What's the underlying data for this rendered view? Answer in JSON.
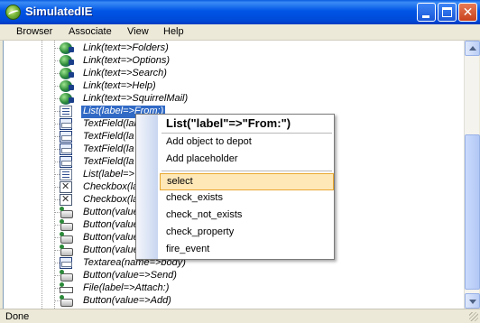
{
  "window": {
    "title": "SimulatedIE"
  },
  "menubar": {
    "items": [
      "Browser",
      "Associate",
      "View",
      "Help"
    ]
  },
  "tree": {
    "rows": [
      {
        "label": "Link(text=>Folders)",
        "icon": "globe-link-icon"
      },
      {
        "label": "Link(text=>Options)",
        "icon": "globe-link-icon"
      },
      {
        "label": "Link(text=>Search)",
        "icon": "globe-link-icon"
      },
      {
        "label": "Link(text=>Help)",
        "icon": "globe-link-icon"
      },
      {
        "label": "Link(text=>SquirrelMail)",
        "icon": "globe-link-icon"
      },
      {
        "label": "List(label=>From:)",
        "icon": "list-icon",
        "selected": true
      },
      {
        "label": "TextField(lab",
        "icon": "textfield-icon"
      },
      {
        "label": "TextField(la",
        "icon": "textfield-icon"
      },
      {
        "label": "TextField(la",
        "icon": "textfield-icon"
      },
      {
        "label": "TextField(la",
        "icon": "textfield-icon"
      },
      {
        "label": "List(label=>",
        "icon": "list-icon"
      },
      {
        "label": "Checkbox(la",
        "icon": "checkbox-icon"
      },
      {
        "label": "Checkbox(la",
        "icon": "checkbox-icon"
      },
      {
        "label": "Button(value",
        "icon": "button-icon"
      },
      {
        "label": "Button(value",
        "icon": "button-icon"
      },
      {
        "label": "Button(value",
        "icon": "button-icon"
      },
      {
        "label": "Button(value",
        "icon": "button-icon"
      },
      {
        "label": "Textarea(name=>body)",
        "icon": "textfield-icon"
      },
      {
        "label": "Button(value=>Send)",
        "icon": "button-icon"
      },
      {
        "label": "File(label=>Attach:)",
        "icon": "file-icon"
      },
      {
        "label": "Button(value=>Add)",
        "icon": "button-icon"
      }
    ]
  },
  "context_menu": {
    "header": "List(\"label\"=>\"From:\")",
    "group1": [
      "Add object to depot",
      "Add placeholder"
    ],
    "group2": [
      "select",
      "check_exists",
      "check_not_exists",
      "check_property",
      "fire_event"
    ],
    "highlighted": "select"
  },
  "status": {
    "text": "Done"
  }
}
